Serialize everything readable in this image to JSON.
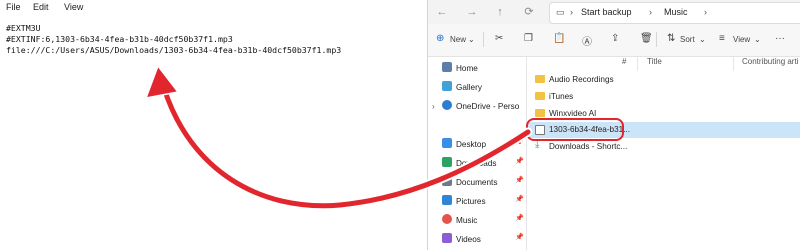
{
  "notepad": {
    "menu": [
      "File",
      "Edit",
      "View"
    ],
    "lines": [
      "#EXTM3U",
      "#EXTINF:6,1303-6b34-4fea-b31b-40dcf50b37f1.mp3",
      "file:///C:/Users/ASUS/Downloads/1303-6b34-4fea-b31b-40dcf50b37f1.mp3"
    ]
  },
  "explorer": {
    "breadcrumb": [
      "Start backup",
      "Music"
    ],
    "toolbar": {
      "new_label": "New",
      "sort_label": "Sort",
      "view_label": "View",
      "more": "···"
    },
    "columns": {
      "hash": "#",
      "title": "Title",
      "contributing": "Contributing arti"
    },
    "sidebar": [
      {
        "label": "Home",
        "icon": "home-icon"
      },
      {
        "label": "Gallery",
        "icon": "gallery-icon"
      },
      {
        "label": "OneDrive - Perso",
        "icon": "onedrive-icon"
      },
      {
        "label": "Desktop",
        "icon": "desktop-icon"
      },
      {
        "label": "Downloads",
        "icon": "download-icon"
      },
      {
        "label": "Documents",
        "icon": "documents-icon"
      },
      {
        "label": "Pictures",
        "icon": "pictures-icon"
      },
      {
        "label": "Music",
        "icon": "music-icon"
      },
      {
        "label": "Videos",
        "icon": "videos-icon"
      }
    ],
    "files": [
      {
        "name": "Audio Recordings",
        "type": "folder"
      },
      {
        "name": "iTunes",
        "type": "folder"
      },
      {
        "name": "Winxvideo AI",
        "type": "folder"
      },
      {
        "name": "1303-6b34-4fea-b31...",
        "type": "playlist",
        "selected": true
      },
      {
        "name": "Downloads - Shortc...",
        "type": "shortcut"
      }
    ]
  },
  "colors": {
    "annotation": "#e1262d",
    "selection": "#cce4f7",
    "folder": "#f2c343"
  }
}
